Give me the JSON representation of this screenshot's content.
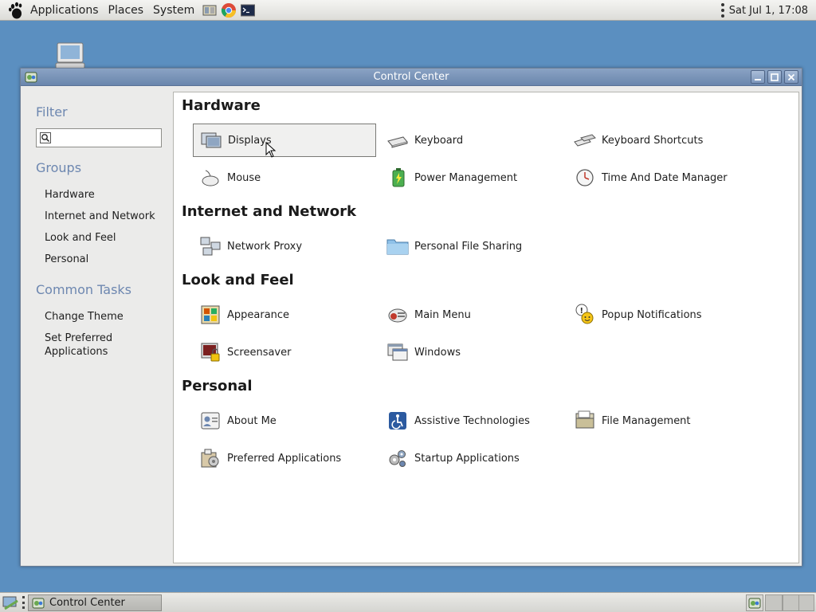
{
  "top_panel": {
    "menus": [
      "Applications",
      "Places",
      "System"
    ],
    "launchers": [
      "file-manager-icon",
      "chrome-icon",
      "terminal-icon"
    ],
    "clock": "Sat Jul  1, 17:08"
  },
  "window": {
    "title": "Control Center",
    "sidebar": {
      "filter_heading": "Filter",
      "filter_value": "",
      "groups_heading": "Groups",
      "groups": [
        "Hardware",
        "Internet and Network",
        "Look and Feel",
        "Personal"
      ],
      "tasks_heading": "Common Tasks",
      "tasks": [
        "Change Theme",
        "Set Preferred\nApplications"
      ]
    },
    "sections": [
      {
        "title": "Hardware",
        "items": [
          {
            "label": "Displays",
            "icon": "displays-icon"
          },
          {
            "label": "Keyboard",
            "icon": "keyboard-icon"
          },
          {
            "label": "Keyboard Shortcuts",
            "icon": "keyboard-shortcuts-icon"
          },
          {
            "label": "Mouse",
            "icon": "mouse-icon"
          },
          {
            "label": "Power Management",
            "icon": "power-management-icon"
          },
          {
            "label": "Time And Date Manager",
            "icon": "clock-icon"
          }
        ]
      },
      {
        "title": "Internet and Network",
        "items": [
          {
            "label": "Network Proxy",
            "icon": "network-proxy-icon"
          },
          {
            "label": "Personal File Sharing",
            "icon": "folder-share-icon"
          }
        ]
      },
      {
        "title": "Look and Feel",
        "items": [
          {
            "label": "Appearance",
            "icon": "appearance-icon"
          },
          {
            "label": "Main Menu",
            "icon": "main-menu-icon"
          },
          {
            "label": "Popup Notifications",
            "icon": "popup-notifications-icon"
          },
          {
            "label": "Screensaver",
            "icon": "screensaver-icon"
          },
          {
            "label": "Windows",
            "icon": "windows-icon"
          }
        ]
      },
      {
        "title": "Personal",
        "items": [
          {
            "label": "About Me",
            "icon": "about-me-icon"
          },
          {
            "label": "Assistive Technologies",
            "icon": "accessibility-icon"
          },
          {
            "label": "File Management",
            "icon": "file-management-icon"
          },
          {
            "label": "Preferred Applications",
            "icon": "preferred-applications-icon"
          },
          {
            "label": "Startup Applications",
            "icon": "startup-applications-icon"
          }
        ]
      }
    ],
    "selected_item": "Displays"
  },
  "bottom_panel": {
    "task_label": "Control Center"
  },
  "colors": {
    "desktop": "#5b8fc0",
    "titlebar": "#7593b8",
    "sidebar_heading": "#6d87b0"
  }
}
